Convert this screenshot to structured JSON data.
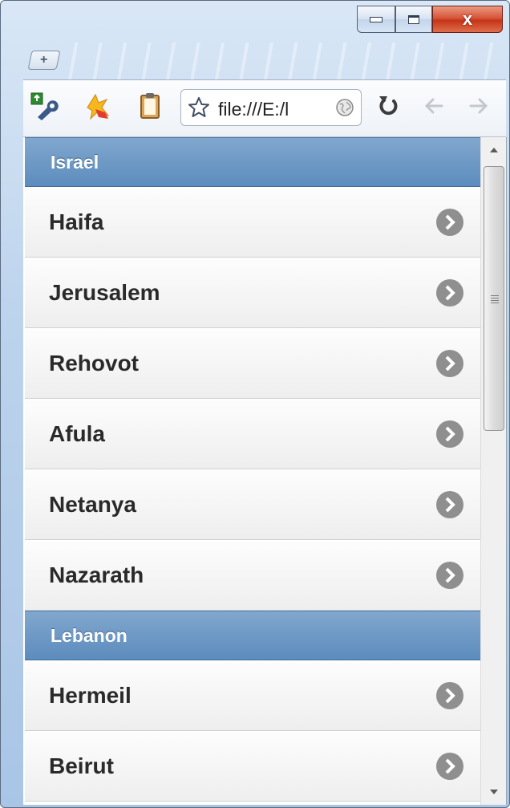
{
  "window": {
    "controls": {
      "minimize_icon": "minimize-icon",
      "maximize_icon": "maximize-icon",
      "close_label": "x"
    }
  },
  "toolbar": {
    "address_text": "file:///E:/l",
    "extensions": [
      "wrench-extension-icon",
      "star-burst-extension-icon",
      "clipboard-extension-icon"
    ],
    "nav_icons": [
      "reload-icon",
      "back-arrow-icon",
      "forward-arrow-icon"
    ]
  },
  "list": {
    "groups": [
      {
        "header": "Israel",
        "items": [
          "Haifa",
          "Jerusalem",
          "Rehovot",
          "Afula",
          "Netanya",
          "Nazarath"
        ]
      },
      {
        "header": "Lebanon",
        "items": [
          "Hermeil",
          "Beirut"
        ]
      }
    ]
  },
  "colors": {
    "divider": "#5c8cbd",
    "item_text": "#2a2a2a",
    "arrow": "#8f8f8f"
  }
}
